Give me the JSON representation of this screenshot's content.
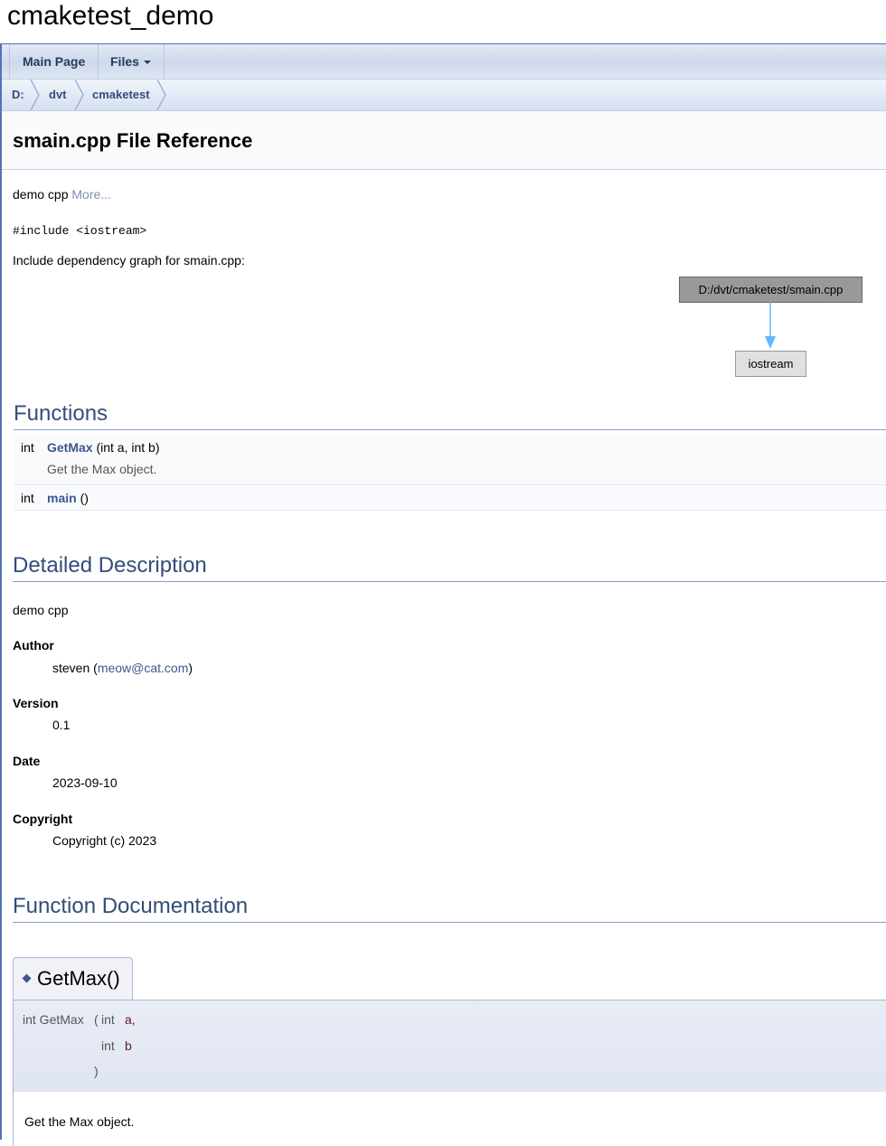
{
  "project": {
    "name": "cmaketest_demo"
  },
  "tabs": [
    {
      "label": "Main Page"
    },
    {
      "label": "Files"
    }
  ],
  "navpath": [
    "D:",
    "dvt",
    "cmaketest"
  ],
  "page": {
    "title": "smain.cpp File Reference",
    "brief": "demo cpp",
    "more_link": "More...",
    "include_line": "#include <iostream>",
    "graph_caption": "Include dependency graph for smain.cpp:"
  },
  "graph": {
    "main_node": "D:/dvt/cmaketest/smain.cpp",
    "dep_node": "iostream"
  },
  "functions": {
    "heading": "Functions",
    "rows": [
      {
        "type": "int",
        "name": "GetMax",
        "args": " (int a, int b)",
        "desc": "Get the Max object."
      },
      {
        "type": "int",
        "name": "main",
        "args": " ()",
        "desc": ""
      }
    ]
  },
  "detailed": {
    "heading": "Detailed Description",
    "brief": "demo cpp",
    "author_label": "Author",
    "author_prefix": "steven (",
    "author_email": "meow@cat.com",
    "author_suffix": ")",
    "version_label": "Version",
    "version": "0.1",
    "date_label": "Date",
    "date": "2023-09-10",
    "copyright_label": "Copyright",
    "copyright": "Copyright (c) 2023"
  },
  "funcdoc": {
    "heading": "Function Documentation",
    "member_title": "GetMax()",
    "proto_return": "int GetMax",
    "proto_open": "(",
    "param1_type": "int",
    "param1_name": "a,",
    "param2_type": "int",
    "param2_name": "b",
    "proto_close": ")",
    "doc": "Get the Max object."
  },
  "colors": {
    "link": "#3d578c",
    "heading": "#354c7b",
    "border": "#5373b4"
  }
}
